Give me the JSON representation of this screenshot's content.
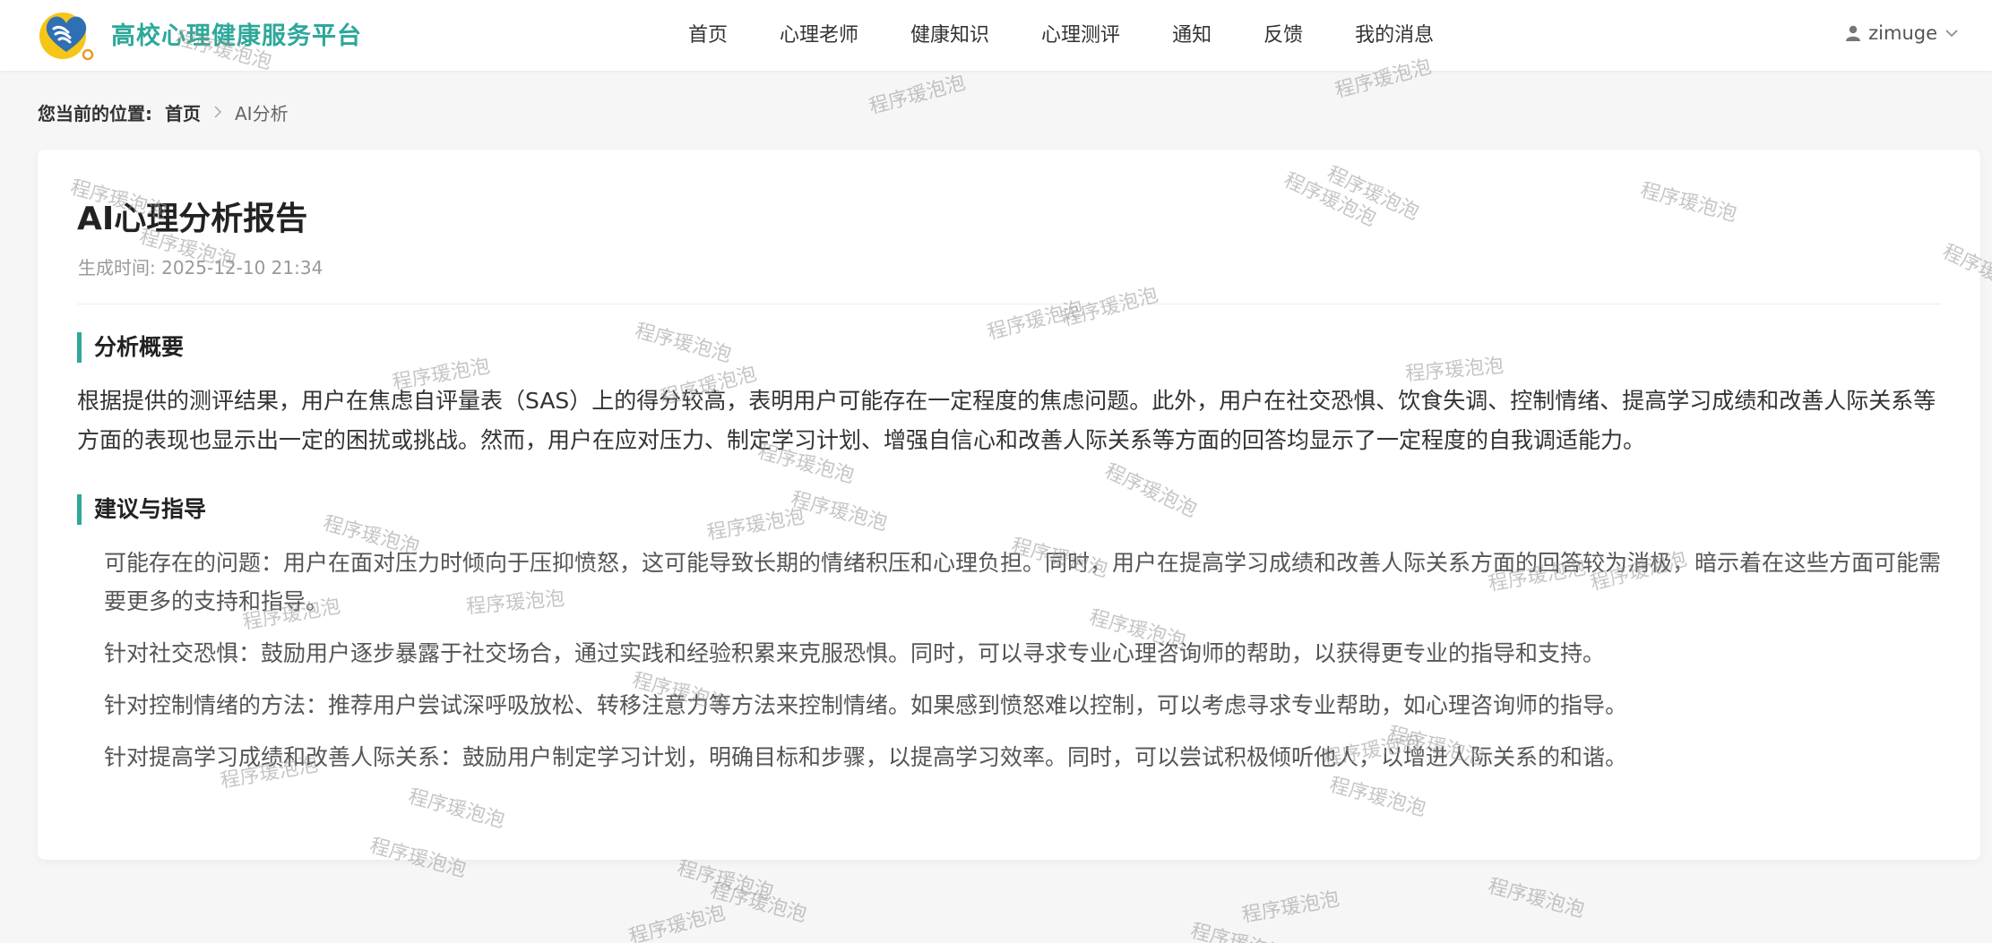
{
  "header": {
    "brand": "高校心理健康服务平台",
    "nav": [
      {
        "label": "首页"
      },
      {
        "label": "心理老师"
      },
      {
        "label": "健康知识"
      },
      {
        "label": "心理测评"
      },
      {
        "label": "通知"
      },
      {
        "label": "反馈"
      },
      {
        "label": "我的消息"
      }
    ],
    "user": {
      "name": "zimuge",
      "icon": "user-icon"
    }
  },
  "breadcrumb": {
    "prefix": "您当前的位置:",
    "home": "首页",
    "current": "AI分析"
  },
  "report": {
    "title": "AI心理分析报告",
    "generated_at": "生成时间: 2025-12-10 21:34",
    "summary_title": "分析概要",
    "summary": "根据提供的测评结果，用户在焦虑自评量表（SAS）上的得分较高，表明用户可能存在一定程度的焦虑问题。此外，用户在社交恐惧、饮食失调、控制情绪、提高学习成绩和改善人际关系等方面的表现也显示出一定的困扰或挑战。然而，用户在应对压力、制定学习计划、增强自信心和改善人际关系等方面的回答均显示了一定程度的自我调适能力。",
    "advice_title": "建议与指导",
    "advice": [
      "可能存在的问题：用户在面对压力时倾向于压抑愤怒，这可能导致长期的情绪积压和心理负担。同时，用户在提高学习成绩和改善人际关系方面的回答较为消极，暗示着在这些方面可能需要更多的支持和指导。",
      "针对社交恐惧：鼓励用户逐步暴露于社交场合，通过实践和经验积累来克服恐惧。同时，可以寻求专业心理咨询师的帮助，以获得更专业的指导和支持。",
      "针对控制情绪的方法：推荐用户尝试深呼吸放松、转移注意力等方法来控制情绪。如果感到愤怒难以控制，可以考虑寻求专业帮助，如心理咨询师的指导。",
      "针对提高学习成绩和改善人际关系：鼓励用户制定学习计划，明确目标和步骤，以提高学习效率。同时，可以尝试积极倾听他人，以增进人际关系的和谐。"
    ]
  },
  "watermark": "程序瑗泡泡",
  "colors": {
    "accent": "#2ea89a",
    "logo_yellow": "#f5c518",
    "background": "#f6f6f6"
  }
}
